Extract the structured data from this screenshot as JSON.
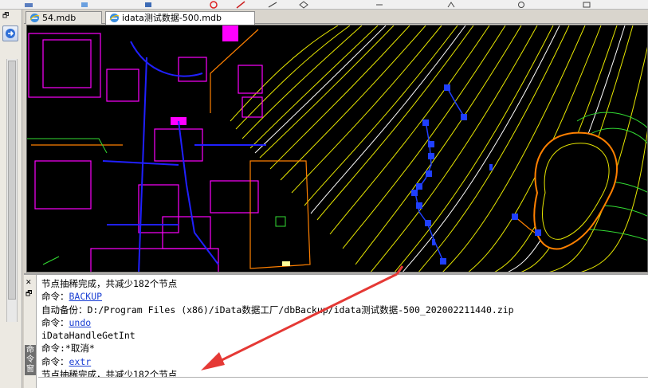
{
  "tabs": [
    {
      "label": "54.mdb",
      "active": false
    },
    {
      "label": "idata测试数据-500.mdb",
      "active": true
    }
  ],
  "command_window": {
    "title": "命令窗",
    "lines": [
      {
        "text": "节点抽稀完成，共减少182个节点"
      },
      {
        "prefix": "命令：",
        "link": "BACKUP"
      },
      {
        "text": "自动备份：D:/Program Files (x86)/iData数据工厂/dbBackup/idata测试数据-500_202002211440.zip"
      },
      {
        "prefix": "命令：",
        "link": "undo"
      },
      {
        "text": "iDataHandleGetInt"
      },
      {
        "text": "命令:*取消*"
      },
      {
        "prefix": "命令：",
        "link": "extr"
      },
      {
        "text": "节点抽稀完成，共减少182个节点"
      }
    ],
    "input_value": ""
  },
  "colors": {
    "contour_yellow": "#e8e800",
    "contour_white": "#ffffff",
    "contour_green": "#33dd33",
    "building_magenta": "#ff00ff",
    "road_blue": "#2020ff",
    "boundary_orange": "#ff8000",
    "node_blue": "#1f3fff",
    "annotation_red": "#e53935"
  },
  "icons": {
    "tab": "ie-icon",
    "nav": "arrow-right-icon",
    "close": "close-icon"
  }
}
